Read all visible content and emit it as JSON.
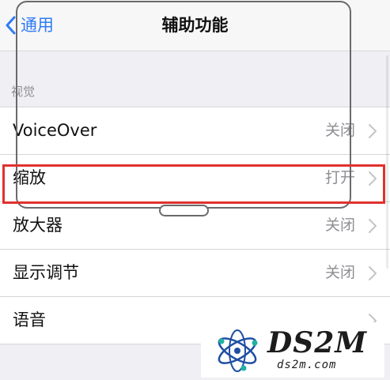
{
  "navbar": {
    "back_label": "通用",
    "title": "辅助功能"
  },
  "section": {
    "header": "视觉"
  },
  "rows": [
    {
      "label": "VoiceOver",
      "value": "关闭"
    },
    {
      "label": "缩放",
      "value": "打开"
    },
    {
      "label": "放大器",
      "value": "关闭"
    },
    {
      "label": "显示调节",
      "value": "关闭"
    },
    {
      "label": "语音",
      "value": ""
    }
  ],
  "watermark": {
    "brand": "DS2M",
    "domain": "ds2m.com"
  },
  "colors": {
    "accent": "#2f7cf6",
    "highlight": "#e0322e",
    "background": "#efeff4",
    "secondary_text": "#8e8e93"
  },
  "icons": {
    "back": "chevron-left-icon",
    "disclosure": "chevron-right-icon"
  }
}
